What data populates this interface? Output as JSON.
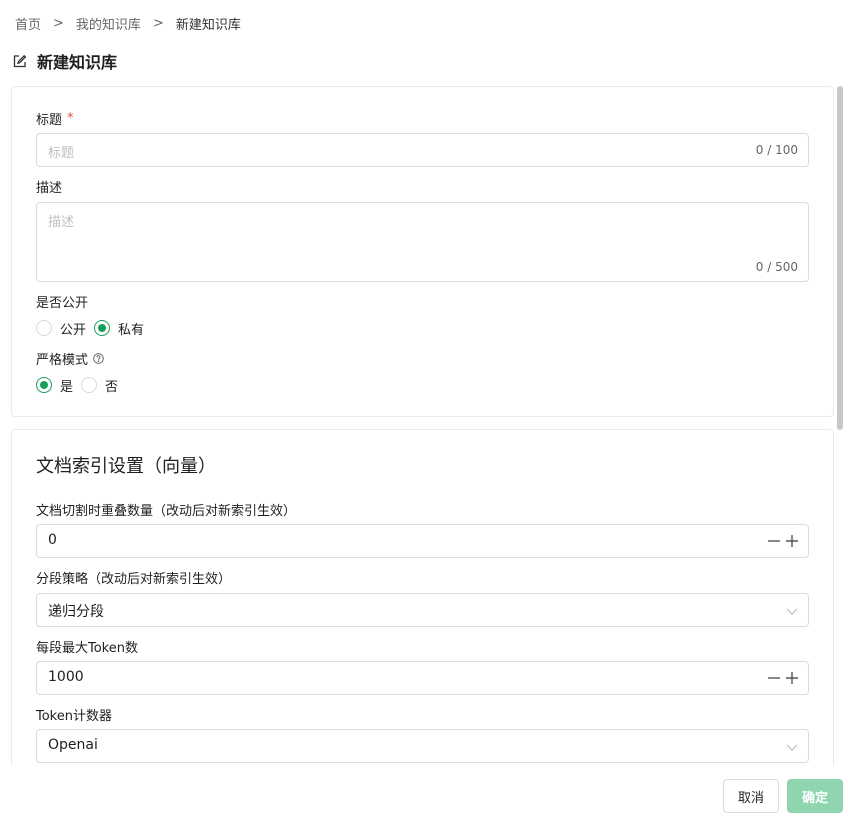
{
  "breadcrumb": {
    "items": [
      "首页",
      "我的知识库",
      "新建知识库"
    ],
    "separator": ">"
  },
  "page": {
    "title": "新建知识库"
  },
  "basic": {
    "title_label": "标题",
    "title_required": "*",
    "title_placeholder": "标题",
    "title_count": "0 / 100",
    "desc_label": "描述",
    "desc_placeholder": "描述",
    "desc_count": "0 / 500",
    "public_label": "是否公开",
    "public_options": [
      "公开",
      "私有"
    ],
    "public_selected": "私有",
    "strict_label": "严格模式",
    "strict_options": [
      "是",
      "否"
    ],
    "strict_selected": "是"
  },
  "index": {
    "section_title": "文档索引设置（向量）",
    "overlap_label": "文档切割时重叠数量（改动后对新索引生效）",
    "overlap_value": "0",
    "strategy_label": "分段策略（改动后对新索引生效）",
    "strategy_value": "递归分段",
    "max_token_label": "每段最大Token数",
    "max_token_value": "1000",
    "counter_label": "Token计数器",
    "counter_value": "Openai"
  },
  "footer": {
    "cancel_label": "取消",
    "confirm_label": "确定"
  },
  "colors": {
    "accent": "#16a05e",
    "confirm_disabled": "#8fd5b0",
    "required": "#e54d42"
  }
}
